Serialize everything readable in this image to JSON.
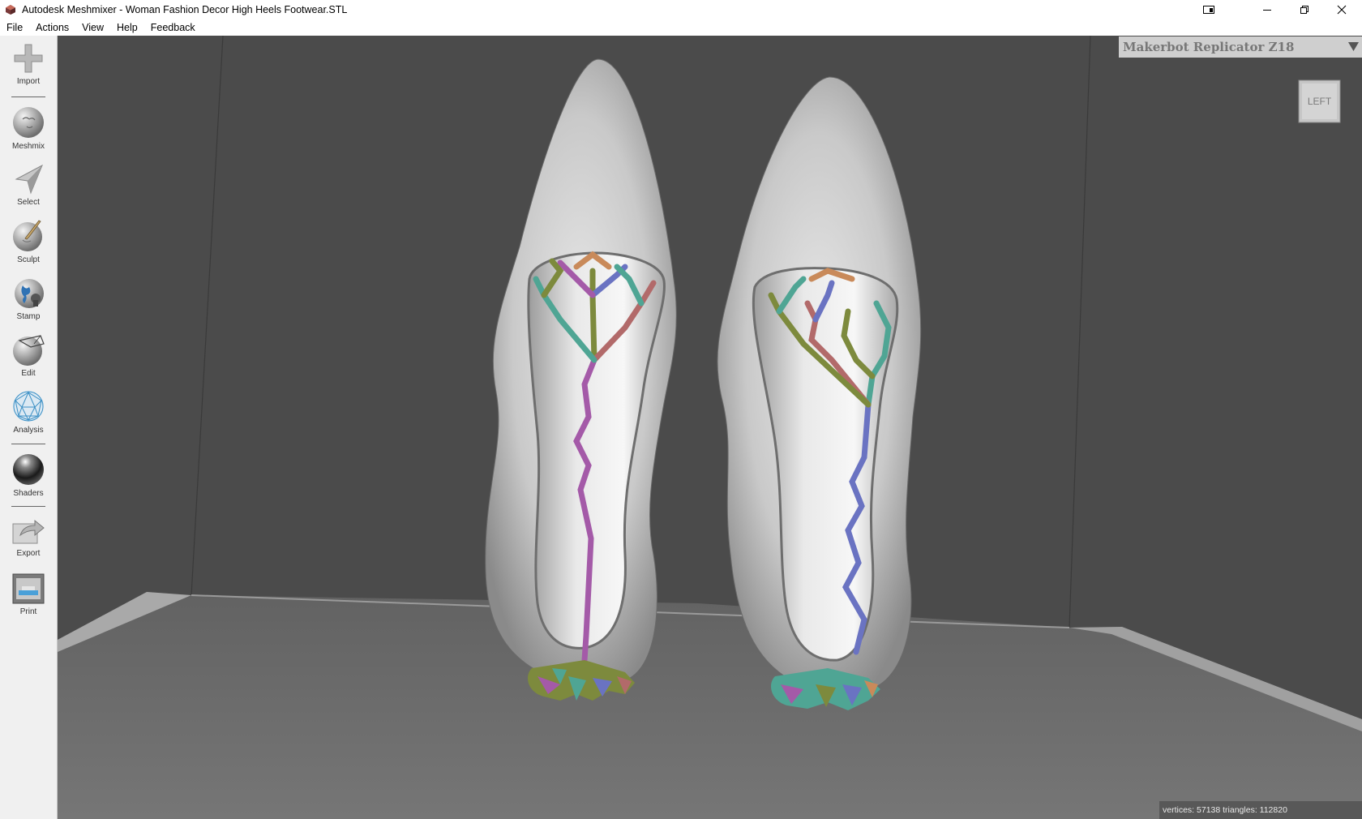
{
  "window": {
    "title": "Autodesk Meshmixer - Woman Fashion Decor High Heels Footwear.STL",
    "controls": [
      "minimize-icon",
      "restore-icon",
      "close-icon"
    ]
  },
  "menu": {
    "file": "File",
    "actions": "Actions",
    "view": "View",
    "help": "Help",
    "feedback": "Feedback"
  },
  "toolbar": {
    "import": "Import",
    "meshmix": "Meshmix",
    "select": "Select",
    "sculpt": "Sculpt",
    "stamp": "Stamp",
    "edit": "Edit",
    "analysis": "Analysis",
    "shaders": "Shaders",
    "export": "Export",
    "print": "Print"
  },
  "printer": {
    "selected": "Makerbot Replicator Z18"
  },
  "viewcube": {
    "face": "LEFT"
  },
  "status": {
    "text": "vertices: 57138 triangles: 112820"
  },
  "colors": {
    "viewport_bg": "#4a4a4a",
    "floor": "#6b6b6b",
    "support_purple": "#a45aa8",
    "support_teal": "#4fa594",
    "support_olive": "#7d8a3d",
    "support_blue": "#6a73c2"
  }
}
